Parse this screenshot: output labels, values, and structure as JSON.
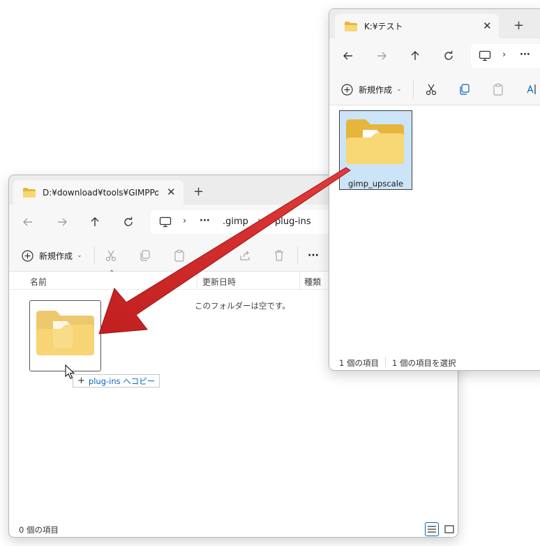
{
  "left_window": {
    "tab_title": "D:¥download¥tools¥GIMPPortable",
    "tab_close": "✕",
    "new_tab": "+",
    "breadcrumb_more": "···",
    "breadcrumb": [
      ".gimp",
      "plug-ins"
    ],
    "new_label": "新規作成",
    "more_label": "···",
    "columns": {
      "name": "名前",
      "date": "更新日時",
      "type": "種類"
    },
    "empty_message": "このフォルダーは空です。",
    "drag_tooltip": "plug-ins へコピー",
    "drag_tooltip_plus": "+",
    "status_count": "0 個の項目"
  },
  "right_window": {
    "tab_title": "K:¥テスト",
    "tab_close": "✕",
    "new_tab": "+",
    "breadcrumb_more": "···",
    "new_label": "新規作成",
    "folder_name": "gimp_upscale",
    "status_count": "1 個の項目",
    "status_selected": "1 個の項目を選択"
  },
  "colors": {
    "folder_back": "#e7b53c",
    "folder_front": "#f8d775",
    "selection_fill": "#cce4f7",
    "arrow_red": "#d52b2b",
    "accent": "#0067c0"
  }
}
